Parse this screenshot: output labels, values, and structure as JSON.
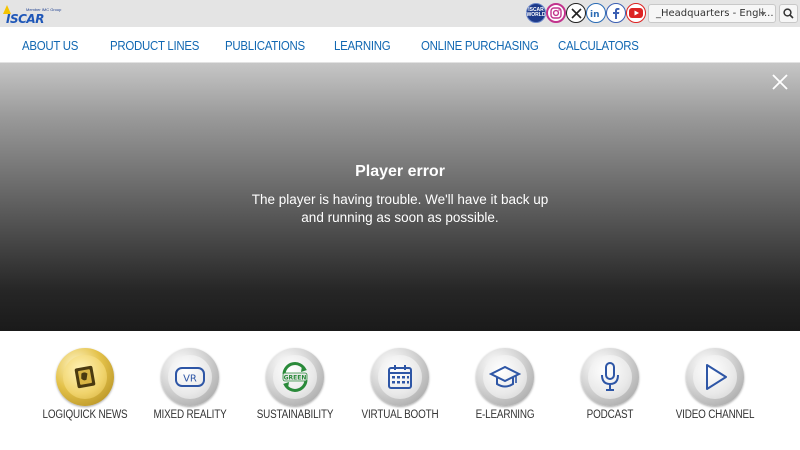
{
  "brand": {
    "logo_word": "ISCAR",
    "logo_tagline": "Member IMC Group"
  },
  "social": {
    "world_label": "ISCAR WORLD",
    "icons": [
      "world-icon",
      "instagram-icon",
      "x-icon",
      "linkedin-icon",
      "facebook-icon",
      "youtube-icon"
    ]
  },
  "language_select": {
    "value": "_Headquarters - Engli..."
  },
  "nav": {
    "items": [
      "ABOUT US",
      "PRODUCT LINES",
      "PUBLICATIONS",
      "LEARNING",
      "ONLINE PURCHASING",
      "CALCULATORS"
    ]
  },
  "player": {
    "error_title": "Player error",
    "error_message": "The player is having trouble. We'll have it back up and running as soon as possible."
  },
  "tiles": [
    {
      "label": "LOGIQUICK NEWS",
      "icon": "logiquick-news-icon"
    },
    {
      "label": "MIXED REALITY",
      "icon": "vr-headset-icon",
      "icon_text": "VR"
    },
    {
      "label": "SUSTAINABILITY",
      "icon": "green-recycle-icon",
      "icon_text": "GREEN"
    },
    {
      "label": "VIRTUAL BOOTH",
      "icon": "calendar-icon"
    },
    {
      "label": "E-LEARNING",
      "icon": "graduation-cap-icon"
    },
    {
      "label": "PODCAST",
      "icon": "microphone-icon"
    },
    {
      "label": "VIDEO CHANNEL",
      "icon": "play-icon"
    }
  ],
  "colors": {
    "nav_text": "#1268b2",
    "topbar_bg": "#e4e4e4",
    "brand_blue": "#1f57b8",
    "gold": "#e4c24a",
    "icon_blue": "#2e56a6"
  }
}
